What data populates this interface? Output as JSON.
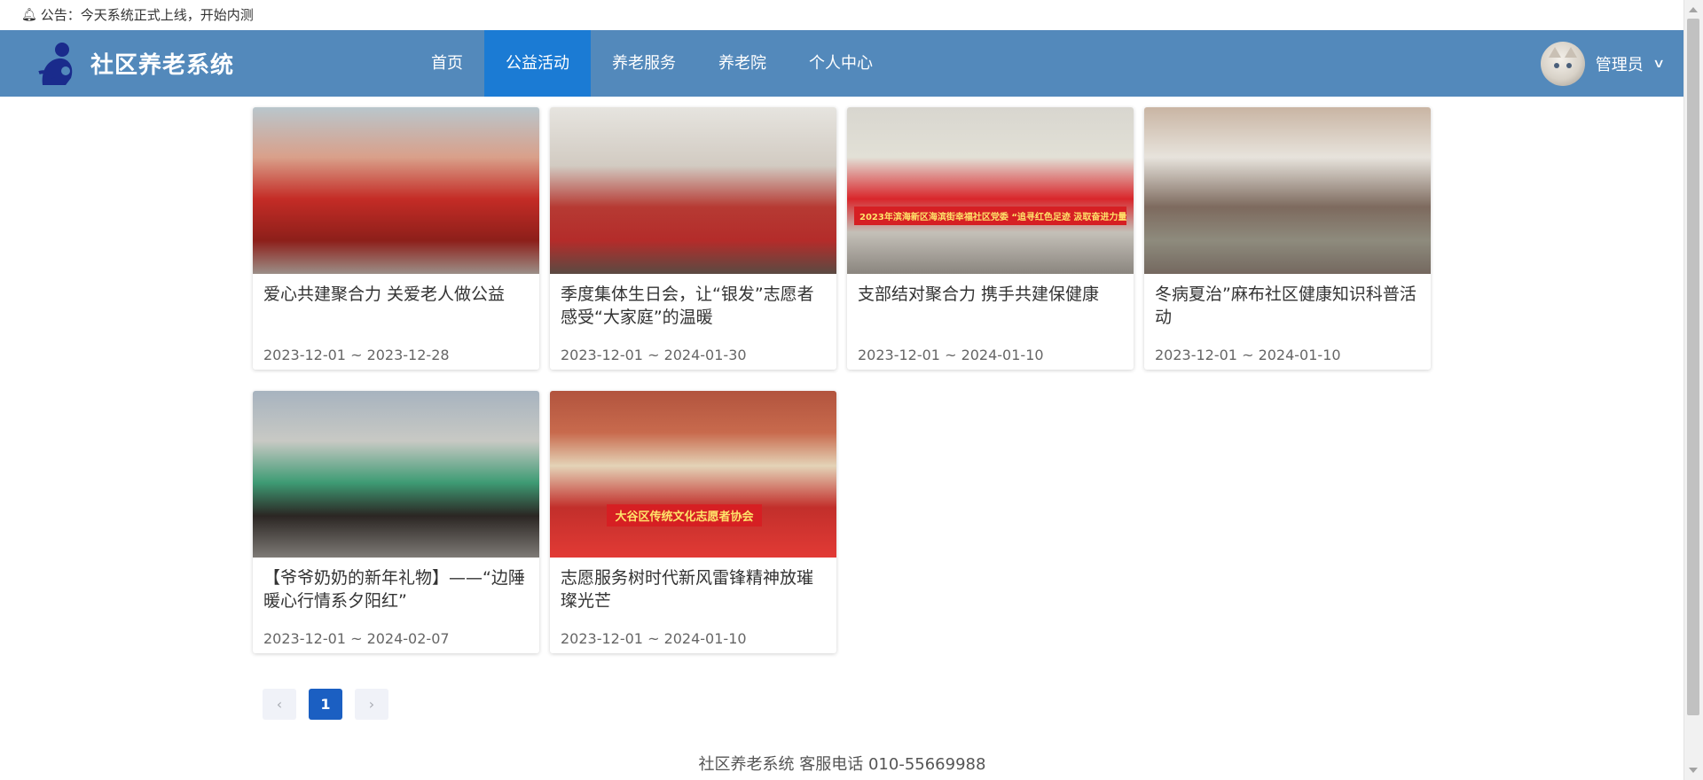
{
  "notice": {
    "icon": "bell-icon",
    "text": "公告：今天系统正式上线，开始内测"
  },
  "header": {
    "logo_icon": "elder-person-logo-icon",
    "title": "社区养老系统",
    "nav": [
      {
        "label": "首页",
        "active": false
      },
      {
        "label": "公益活动",
        "active": true
      },
      {
        "label": "养老服务",
        "active": false
      },
      {
        "label": "养老院",
        "active": false
      },
      {
        "label": "个人中心",
        "active": false
      }
    ],
    "user": {
      "name": "管理员",
      "avatar": "cat-avatar",
      "dropdown_icon": "chevron-down-icon"
    }
  },
  "activities": [
    {
      "title": "爱心共建聚合力 关爱老人做公益",
      "date": "2023-12-01 ~ 2023-12-28"
    },
    {
      "title": "季度集体生日会，让“银发”志愿者感受“大家庭”的温暖",
      "date": "2023-12-01 ~ 2024-01-30"
    },
    {
      "title": "支部结对聚合力 携手共建保健康",
      "date": "2023-12-01 ~ 2024-01-10",
      "photo_banner": "2023年滨海新区海滨街幸福社区党委 “追寻红色足迹 汲取奋进力量”主题党日活动"
    },
    {
      "title": "冬病夏治”麻布社区健康知识科普活动",
      "date": "2023-12-01 ~ 2024-01-10"
    },
    {
      "title": "【爷爷奶奶的新年礼物】——“边陲暖心行情系夕阳红”",
      "date": "2023-12-01 ~ 2024-02-07"
    },
    {
      "title": "志愿服务树时代新风雷锋精神放璀璨光芒",
      "date": "2023-12-01 ~ 2024-01-10",
      "photo_banner": "大谷区传统文化志愿者协会"
    }
  ],
  "pagination": {
    "prev_icon": "chevron-left-icon",
    "current": "1",
    "next_icon": "chevron-right-icon"
  },
  "footer": {
    "text": "社区养老系统 客服电话 010-55669988"
  },
  "colors": {
    "header_bg": "#5389bb",
    "nav_active": "#1b7bd4",
    "page_active": "#1b5fc2"
  }
}
